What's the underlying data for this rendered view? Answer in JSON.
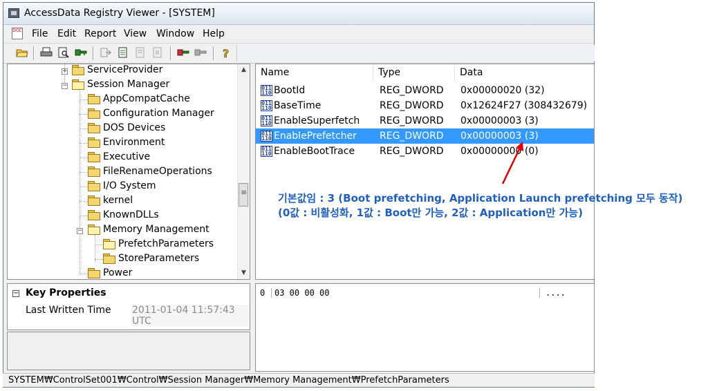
{
  "window": {
    "title": "AccessData Registry Viewer - [SYSTEM]"
  },
  "menu": {
    "doc_icon_text": "DOC",
    "items": [
      "File",
      "Edit",
      "Report",
      "View",
      "Window",
      "Help"
    ]
  },
  "toolbar": {
    "icons": [
      "open-folder-icon",
      "print-icon",
      "print-preview-icon",
      "key-icon",
      "export-icon",
      "report-icon",
      "add-to-report-icon",
      "report-view-icon",
      "red-key-icon",
      "gray-key-icon",
      "help-icon"
    ]
  },
  "tree": {
    "items": [
      {
        "label": "ServiceProvider"
      },
      {
        "label": "Session Manager"
      },
      {
        "label": "AppCompatCache"
      },
      {
        "label": "Configuration Manager"
      },
      {
        "label": "DOS Devices"
      },
      {
        "label": "Environment"
      },
      {
        "label": "Executive"
      },
      {
        "label": "FileRenameOperations"
      },
      {
        "label": "I/O System"
      },
      {
        "label": "kernel"
      },
      {
        "label": "KnownDLLs"
      },
      {
        "label": "Memory Management"
      },
      {
        "label": "PrefetchParameters"
      },
      {
        "label": "StoreParameters"
      },
      {
        "label": "Power"
      }
    ]
  },
  "values": {
    "columns": [
      "Name",
      "Type",
      "Data"
    ],
    "rows": [
      {
        "name": "BootId",
        "type": "REG_DWORD",
        "data": "0x00000020 (32)"
      },
      {
        "name": "BaseTime",
        "type": "REG_DWORD",
        "data": "0x12624F27 (308432679)"
      },
      {
        "name": "EnableSuperfetch",
        "type": "REG_DWORD",
        "data": "0x00000003 (3)"
      },
      {
        "name": "EnablePrefetcher",
        "type": "REG_DWORD",
        "data": "0x00000003 (3)",
        "selected": true
      },
      {
        "name": "EnableBootTrace",
        "type": "REG_DWORD",
        "data": "0x00000000 (0)"
      }
    ],
    "icon_text": "011 110"
  },
  "properties": {
    "header": "Key Properties",
    "collapse_symbol": "−",
    "last_written_label": "Last Written Time",
    "last_written_value": "2011-01-04 11:57:43 UTC"
  },
  "hex": {
    "offset": "0",
    "bytes": "03 00 00 00",
    "ascii": "...."
  },
  "status": {
    "path": "SYSTEM₩ControlSet001₩Control₩Session Manager₩Memory Management₩PrefetchParameters"
  },
  "annotation": {
    "line1": "기본값임 : 3 (Boot prefetching, Application Launch prefetching 모두 동작)",
    "line2": "(0값 : 비활성화, 1값 : Boot만 가능, 2값 : Application만 가능)",
    "color": "#1f5fbf",
    "arrow_color": "#e00000"
  }
}
